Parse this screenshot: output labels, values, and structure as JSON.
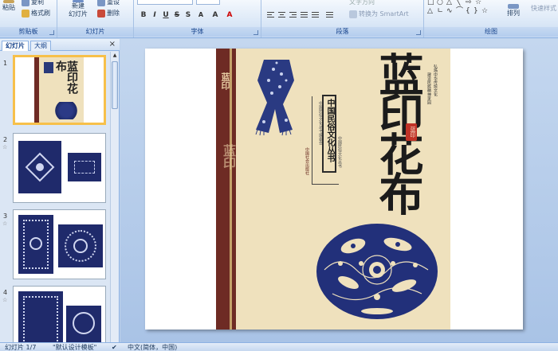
{
  "ribbon": {
    "groups": [
      {
        "label": "剪贴板"
      },
      {
        "label": "幻灯片"
      },
      {
        "label": "字体"
      },
      {
        "label": "段落"
      },
      {
        "label": "绘图"
      }
    ],
    "paste": "粘贴",
    "copy": "复制",
    "format_painter": "格式刷",
    "new_slide_1": "新建",
    "new_slide_2": "幻灯片",
    "reset": "重设",
    "delete": "删除",
    "text_direction": "文字方向",
    "smartart": "转换为 SmartArt",
    "arrange": "排列",
    "quick_styles": "快速样式"
  },
  "pane": {
    "tab_slides": "幻灯片",
    "tab_outline": "大纲",
    "close": "×",
    "thumbs": [
      {
        "num": "1"
      },
      {
        "num": "2"
      },
      {
        "num": "3"
      },
      {
        "num": "4"
      }
    ]
  },
  "cover": {
    "spine_top": "蓝印",
    "spine_bottom": "蓝印",
    "title": "蓝印花布",
    "series": "中国民俗文化丛书",
    "seal": "蓝印",
    "side_text_1": "弘扬中华传统文化",
    "side_text_2": "建设民族精神家园",
    "publisher": "中国社会出版社"
  },
  "status": {
    "slide_info": "幻灯片 1/7",
    "theme": "\"默认设计模板\"",
    "language": "中文(简体，中国)"
  }
}
